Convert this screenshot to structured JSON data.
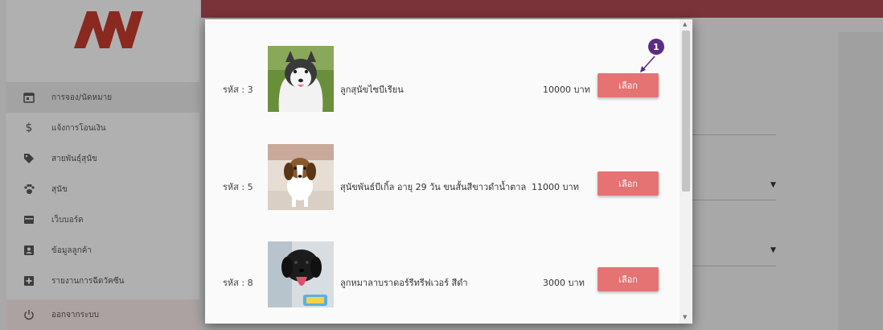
{
  "sidebar": {
    "items": [
      {
        "label": "การจอง/นัดหมาย",
        "icon": "calendar-icon"
      },
      {
        "label": "แจ้งการโอนเงิน",
        "icon": "dollar-icon"
      },
      {
        "label": "สายพันธุ์สุนัข",
        "icon": "tag-icon"
      },
      {
        "label": "สุนัข",
        "icon": "paw-icon"
      },
      {
        "label": "เว็บบอร์ด",
        "icon": "card-icon"
      },
      {
        "label": "ข้อมูลลูกค้า",
        "icon": "account-box-icon"
      },
      {
        "label": "รายงานการฉีดวัคซีน",
        "icon": "medical-plus-icon"
      },
      {
        "label": "ออกจากระบบ",
        "icon": "power-icon"
      }
    ]
  },
  "modal": {
    "items": [
      {
        "code": "รหัส : 3",
        "name": "ลูกสุนัขไซบีเรียน",
        "price": "10000 บาท",
        "button": "เลือก",
        "image": "husky-puppy"
      },
      {
        "code": "รหัส : 5",
        "name": "สุนัขพันธ์บีเกิ้ล อายุ 29 วัน ขนสั้นสีขาวดำน้ำตาล",
        "price": "11000 บาท",
        "button": "เลือก",
        "image": "beagle-puppy"
      },
      {
        "code": "รหัส : 8",
        "name": "ลูกหมาลาบราดอร์รีทรีฟเวอร์ สีดำ",
        "price": "3000 บาท",
        "button": "เลือก",
        "image": "black-labrador-puppy"
      }
    ]
  },
  "callout": {
    "number": "1"
  },
  "colors": {
    "accent": "#e57373",
    "topbar": "#a8474f",
    "marker": "#5b2c83"
  }
}
